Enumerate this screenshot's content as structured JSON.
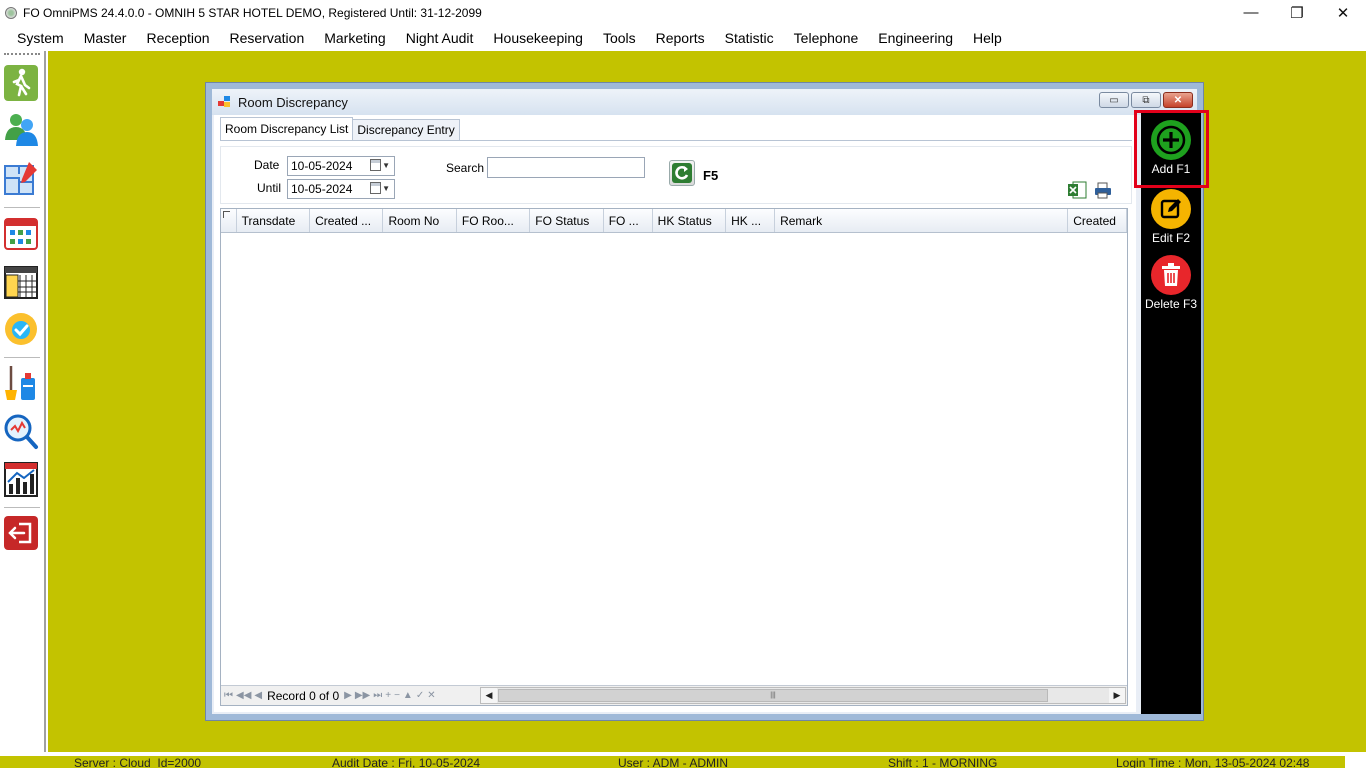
{
  "window": {
    "title": "FO OmniPMS 24.4.0.0 - OMNIH 5 STAR HOTEL DEMO, Registered Until: 31-12-2099",
    "minimize_glyph": "—",
    "restore_glyph": "❐",
    "close_glyph": "✕"
  },
  "menu": [
    "System",
    "Master",
    "Reception",
    "Reservation",
    "Marketing",
    "Night Audit",
    "Housekeeping",
    "Tools",
    "Reports",
    "Statistic",
    "Telephone",
    "Engineering",
    "Help"
  ],
  "toolbar_icons": [
    "walk-in-icon",
    "guests-icon",
    "floor-plan-icon",
    "calendar-grid-icon",
    "calendar-2023-icon",
    "availability-badge-icon",
    "housekeeping-icon",
    "analysis-magnifier-icon",
    "statistics-chart-icon",
    "exit-icon"
  ],
  "child_window": {
    "title": "Room Discrepancy",
    "tabs": [
      "Room Discrepancy List",
      "Discrepancy Entry"
    ],
    "active_tab": "Room Discrepancy List"
  },
  "filter": {
    "date_label": "Date",
    "date_value": "10-05-2024",
    "until_label": "Until",
    "until_value": "10-05-2024",
    "search_label": "Search",
    "search_value": "",
    "refresh_shortcut": "F5"
  },
  "grid": {
    "columns": [
      "Transdate",
      "Created ...",
      "Room No",
      "FO Roo...",
      "FO Status",
      "FO ...",
      "HK Status",
      "HK ...",
      "Remark",
      "Created"
    ],
    "rows": [],
    "navigator_record": "Record 0 of 0"
  },
  "actions": [
    {
      "label": "Add F1",
      "color": "#1ea11e",
      "glyph": "+"
    },
    {
      "label": "Edit F2",
      "color": "#f5b400",
      "glyph": "✎"
    },
    {
      "label": "Delete F3",
      "color": "#e8262b",
      "glyph": "🗑"
    }
  ],
  "status_bar": {
    "server": "Server : Cloud_Id=2000",
    "audit_date": "Audit Date : Fri, 10-05-2024",
    "user": "User : ADM - ADMIN",
    "shift": "Shift : 1 - MORNING",
    "login_time": "Login Time : Mon, 13-05-2024 02:48"
  },
  "colors": {
    "workspace": "#c3c300",
    "highlight": "#e2001a",
    "action_panel": "#000000"
  }
}
